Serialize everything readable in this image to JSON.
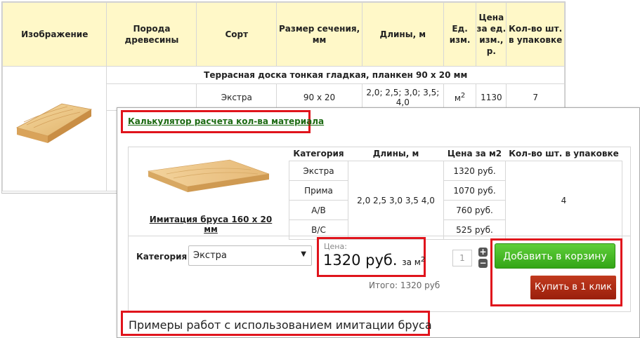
{
  "background_table": {
    "headers": [
      "Изображение",
      "Порода древесины",
      "Сорт",
      "Размер сечения, мм",
      "Длины, м",
      "Ед. изм.",
      "Цена за ед. изм., р.",
      "Кол-во шт. в упаковке"
    ],
    "section_title": "Террасная доска тонкая гладкая, планкен 90 х 20 мм",
    "row": {
      "grade": "Экстра",
      "size": "90 х 20",
      "lengths": "2,0; 2,5; 3,0; 3,5; 4,0",
      "unit": "м",
      "unit_sup": "2",
      "price": "1130",
      "qty": "7"
    }
  },
  "calculator": {
    "link": "Калькулятор расчета кол-ва материала",
    "product_name": "Имитация бруса 160 х 20 мм",
    "table": {
      "headers": [
        "Категория",
        "Длины, м",
        "Цена за м2",
        "Кол-во шт. в упаковке"
      ],
      "categories": [
        "Экстра",
        "Прима",
        "A/B",
        "B/C"
      ],
      "lengths": "2,0 2,5 3,0 3,5 4,0",
      "prices": [
        "1320 руб.",
        "1070 руб.",
        "760 руб.",
        "525 руб."
      ],
      "pack_qty": "4"
    },
    "category_label": "Категория",
    "category_selected": "Экстра",
    "price_caption": "Цена:",
    "price_value": "1320 руб.",
    "price_unit": "за м",
    "price_unit_sup": "2",
    "total": "Итого: 1320 руб",
    "quantity": "1",
    "add_to_cart": "Добавить в корзину",
    "buy_one_click": "Купить в 1 клик",
    "examples_text": "Примеры работ с использованием имитации бруса"
  },
  "colors": {
    "highlight_red": "#e0141c",
    "header_yellow": "#fff8c8",
    "cart_green": "#33a516",
    "buy_red": "#9a1f0c",
    "link_green": "#1c6a12"
  }
}
